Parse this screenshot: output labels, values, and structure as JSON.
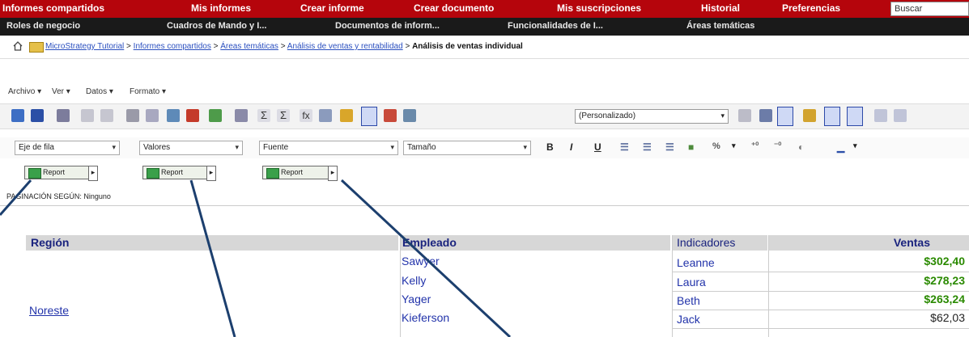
{
  "nav_primary": {
    "items": [
      "Informes compartidos",
      "Mis informes",
      "Crear informe",
      "Crear documento",
      "Mis suscripciones",
      "Historial",
      "Preferencias"
    ],
    "search_placeholder": "Buscar"
  },
  "nav_secondary": {
    "items": [
      "Roles de negocio",
      "Cuadros de Mando y I...",
      "Documentos de inform...",
      "Funcionalidades de I...",
      "Áreas temáticas"
    ]
  },
  "breadcrumb": {
    "links": [
      "MicroStrategy Tutorial",
      "Informes compartidos",
      "Áreas temáticas",
      "Análisis de ventas y rentabilidad"
    ],
    "separator": ">",
    "current": "Análisis de ventas individual"
  },
  "menu": {
    "items": [
      "Archivo",
      "Ver",
      "Datos",
      "Formato"
    ]
  },
  "toolbar": {
    "style_dropdown": "(Personalizado)"
  },
  "format_bar": {
    "axis_select": "Eje de fila",
    "values_select": "Valores",
    "font_select": "Fuente",
    "size_select": "Tamaño",
    "bold": "B",
    "italic": "I",
    "underline": "U",
    "percent": "%"
  },
  "report_buttons": [
    {
      "label": "Report"
    },
    {
      "label": "Report"
    },
    {
      "label": "Report"
    }
  ],
  "paging": {
    "text": "PAGINACIÓN SEGÚN: Ninguno"
  },
  "grid": {
    "headers": {
      "region": "Región",
      "employee": "Empleado",
      "metrics": "Indicadores",
      "sales": "Ventas"
    },
    "region": "Noreste",
    "rows": [
      {
        "employee": "Sawyer",
        "first_name": "Leanne",
        "sales": "$302,40"
      },
      {
        "employee": "Kelly",
        "first_name": "Laura",
        "sales": "$278,23"
      },
      {
        "employee": "Yager",
        "first_name": "Beth",
        "sales": "$263,24"
      },
      {
        "employee": "Kieferson",
        "first_name": "Jack",
        "sales": "$62,03"
      }
    ]
  },
  "colors": {
    "nav_primary_bg": "#b5050c",
    "nav_secondary_bg": "#1a1a1a",
    "header_text": "#1a237e",
    "sales_highlight": "#2a8a00",
    "callout_line": "#1c3f6e"
  }
}
